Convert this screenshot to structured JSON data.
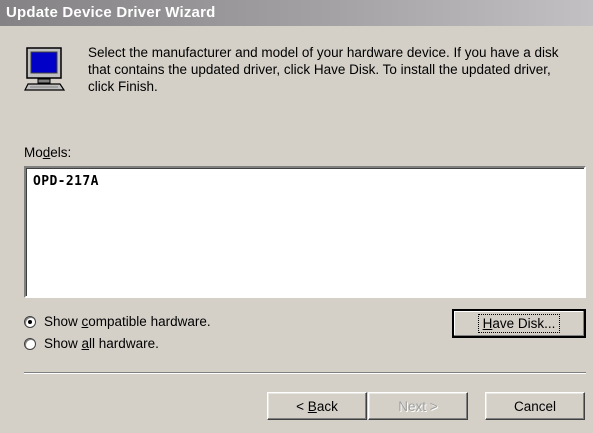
{
  "window": {
    "title": "Update Device Driver Wizard"
  },
  "header": {
    "icon": "monitor-icon",
    "text": "Select the manufacturer and model of your hardware device. If you have a disk that contains the updated driver, click Have Disk. To install the updated driver, click Finish."
  },
  "models": {
    "label_pre": "Mo",
    "label_accel": "d",
    "label_post": "els:",
    "items": [
      "OPD-217A"
    ]
  },
  "options": {
    "compatible": {
      "pre": "Show ",
      "accel": "c",
      "post": "ompatible hardware.",
      "checked": true
    },
    "all": {
      "pre": "Show ",
      "accel": "a",
      "post": "ll hardware.",
      "checked": false
    }
  },
  "buttons": {
    "have_disk": {
      "accel": "H",
      "post": "ave Disk..."
    },
    "back": {
      "pre": "< ",
      "accel": "B",
      "post": "ack"
    },
    "next": "Next >",
    "cancel": "Cancel"
  },
  "colors": {
    "dialog_bg": "#d4d0c8",
    "title_start": "#848284",
    "title_end": "#c2c0c2"
  }
}
